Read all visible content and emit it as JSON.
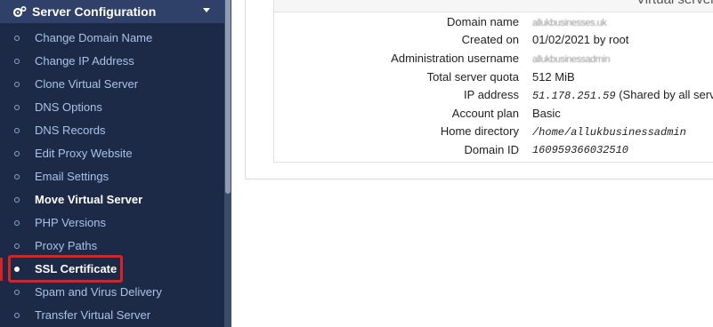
{
  "sidebar": {
    "section_title": "Server Configuration",
    "items": [
      {
        "label": "Change Domain Name"
      },
      {
        "label": "Change IP Address"
      },
      {
        "label": "Clone Virtual Server"
      },
      {
        "label": "DNS Options"
      },
      {
        "label": "DNS Records"
      },
      {
        "label": "Edit Proxy Website"
      },
      {
        "label": "Email Settings"
      },
      {
        "label": "Move Virtual Server"
      },
      {
        "label": "PHP Versions"
      },
      {
        "label": "Proxy Paths"
      },
      {
        "label": "SSL Certificate"
      },
      {
        "label": "Spam and Virus Delivery"
      },
      {
        "label": "Transfer Virtual Server"
      }
    ],
    "active_item": "SSL Certificate"
  },
  "panel": {
    "heading": "Virtual server d",
    "rows": [
      {
        "label": "Domain name",
        "value": "allukbusinesses.uk"
      },
      {
        "label": "Created on",
        "value": "01/02/2021 by root"
      },
      {
        "label": "Administration username",
        "value": "allukbusinessadmin"
      },
      {
        "label": "Total server quota",
        "value": "512 MiB"
      },
      {
        "label": "IP address",
        "value": "51.178.251.59",
        "value_note": "(Shared by all servers)"
      },
      {
        "label": "Account plan",
        "value": "Basic"
      },
      {
        "label": "Home directory",
        "value": "/home/allukbusinessadmin"
      },
      {
        "label": "Domain ID",
        "value": "160959366032510"
      }
    ]
  },
  "colors": {
    "sidebar_bg": "#1c2a47",
    "header_bg": "#2f4069",
    "menu_text": "#a9c2e6",
    "highlight": "#e02020"
  }
}
